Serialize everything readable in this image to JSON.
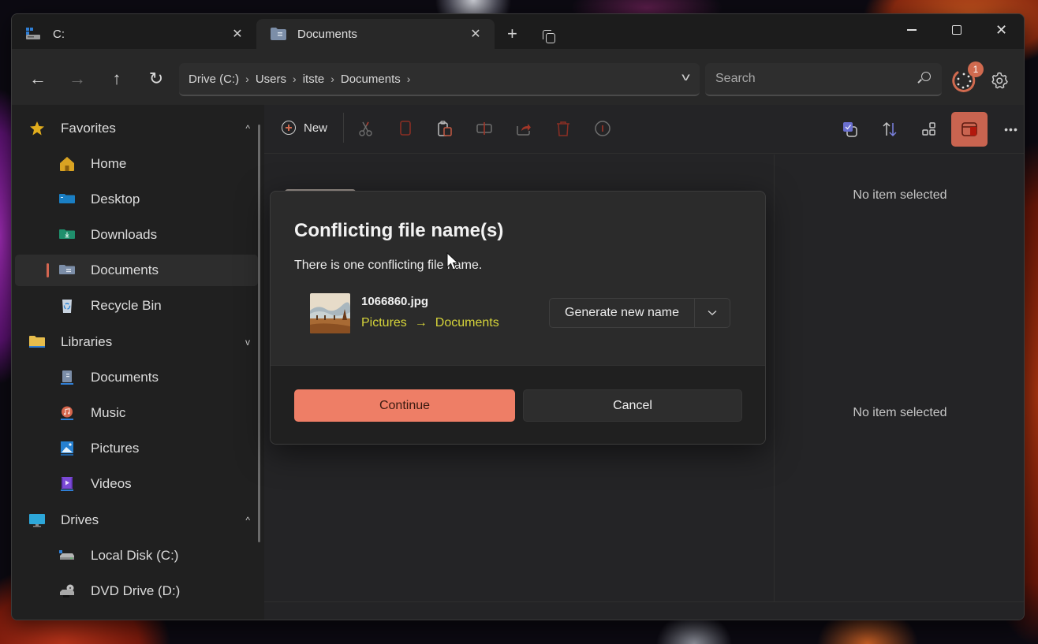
{
  "window": {
    "tabs": [
      {
        "label": "C:",
        "icon": "drive-icon",
        "active": false
      },
      {
        "label": "Documents",
        "icon": "documents-folder-icon",
        "active": true
      }
    ],
    "new_tab_label": "+",
    "controls": {
      "minimize": "minimize",
      "maximize": "maximize",
      "close": "close"
    }
  },
  "navbar": {
    "back": "←",
    "forward": "→",
    "up": "↑",
    "refresh": "↻",
    "breadcrumb": [
      "Drive (C:)",
      "Users",
      "itste",
      "Documents"
    ],
    "breadcrumb_separator": "›",
    "address_dropdown": "v",
    "search_placeholder": "Search",
    "search_value": "",
    "status_badge_count": "1"
  },
  "sidebar": {
    "sections": [
      {
        "label": "Favorites",
        "icon": "star-icon",
        "expanded": true,
        "chevron": "^",
        "items": [
          {
            "label": "Home",
            "icon": "home-icon"
          },
          {
            "label": "Desktop",
            "icon": "desktop-folder-icon"
          },
          {
            "label": "Downloads",
            "icon": "downloads-folder-icon"
          },
          {
            "label": "Documents",
            "icon": "documents-folder-icon",
            "selected": true
          },
          {
            "label": "Recycle Bin",
            "icon": "recycle-bin-icon"
          }
        ]
      },
      {
        "label": "Libraries",
        "icon": "folder-icon",
        "expanded": true,
        "chevron": "v",
        "items": [
          {
            "label": "Documents",
            "icon": "documents-library-icon"
          },
          {
            "label": "Music",
            "icon": "music-library-icon"
          },
          {
            "label": "Pictures",
            "icon": "pictures-library-icon"
          },
          {
            "label": "Videos",
            "icon": "videos-library-icon"
          }
        ]
      },
      {
        "label": "Drives",
        "icon": "monitor-icon",
        "expanded": true,
        "chevron": "^",
        "items": [
          {
            "label": "Local Disk (C:)",
            "icon": "local-disk-icon"
          },
          {
            "label": "DVD Drive (D:)",
            "icon": "dvd-drive-icon"
          }
        ]
      }
    ]
  },
  "toolbar": {
    "new_label": "New",
    "actions": [
      "cut",
      "copy",
      "paste",
      "rename",
      "share",
      "delete",
      "properties"
    ],
    "right_actions": [
      "select",
      "sort",
      "layout",
      "preview-pane",
      "more"
    ],
    "more_label": "•••"
  },
  "preview": {
    "top_text": "No item selected",
    "bottom_text": "No item selected"
  },
  "dialog": {
    "title": "Conflicting file name(s)",
    "message": "There is one conflicting file name.",
    "conflict": {
      "file_name": "1066860.jpg",
      "source": "Pictures",
      "arrow": "→",
      "destination": "Documents",
      "resolution": "Generate new name"
    },
    "continue_label": "Continue",
    "cancel_label": "Cancel"
  },
  "colors": {
    "accent": "#ee7e66",
    "selection_indicator": "#d36550",
    "path_text": "#d6d43a",
    "badge": "#d06a4f"
  }
}
